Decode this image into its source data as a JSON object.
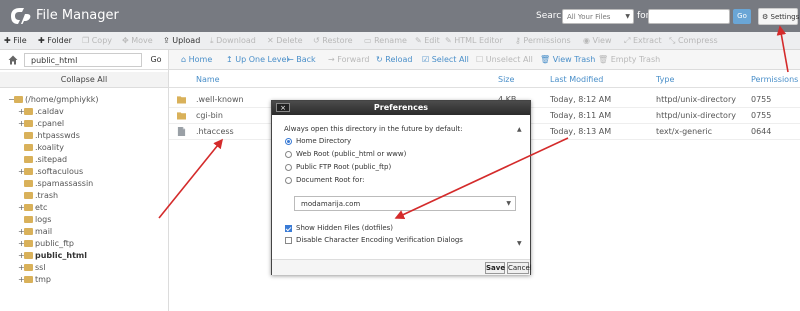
{
  "header": {
    "app_title": "File Manager",
    "search_label": "Search",
    "search_scope": "All Your Files",
    "for_label": "for",
    "search_value": "",
    "go_label": "Go",
    "settings_label": "Settings"
  },
  "toolbar": {
    "items": [
      {
        "label": "File",
        "icon": "plus-icon",
        "enabled": true
      },
      {
        "label": "Folder",
        "icon": "plus-icon",
        "enabled": true
      },
      {
        "label": "Copy",
        "icon": "copy-icon",
        "enabled": false
      },
      {
        "label": "Move",
        "icon": "move-icon",
        "enabled": false
      },
      {
        "label": "Upload",
        "icon": "upload-icon",
        "enabled": true
      },
      {
        "label": "Download",
        "icon": "download-icon",
        "enabled": false
      },
      {
        "label": "Delete",
        "icon": "delete-icon",
        "enabled": false
      },
      {
        "label": "Restore",
        "icon": "restore-icon",
        "enabled": false
      },
      {
        "label": "Rename",
        "icon": "rename-icon",
        "enabled": false
      },
      {
        "label": "Edit",
        "icon": "pencil-icon",
        "enabled": false
      },
      {
        "label": "HTML Editor",
        "icon": "pencil-icon",
        "enabled": false
      },
      {
        "label": "Permissions",
        "icon": "key-icon",
        "enabled": false
      },
      {
        "label": "View",
        "icon": "eye-icon",
        "enabled": false
      },
      {
        "label": "Extract",
        "icon": "expand-icon",
        "enabled": false
      },
      {
        "label": "Compress",
        "icon": "compress-icon",
        "enabled": false
      }
    ]
  },
  "sidebar": {
    "path_value": "public_html",
    "go_label": "Go",
    "collapse_label": "Collapse All",
    "tree": [
      {
        "pm": "−",
        "label": "(/home/gmphiykk)",
        "level": 0,
        "bold": false
      },
      {
        "pm": "+",
        "label": ".caldav",
        "level": 1,
        "bold": false
      },
      {
        "pm": "+",
        "label": ".cpanel",
        "level": 1,
        "bold": false
      },
      {
        "pm": "",
        "label": ".htpasswds",
        "level": 1,
        "bold": false
      },
      {
        "pm": "",
        "label": ".koality",
        "level": 1,
        "bold": false
      },
      {
        "pm": "",
        "label": ".sitepad",
        "level": 1,
        "bold": false
      },
      {
        "pm": "+",
        "label": ".softaculous",
        "level": 1,
        "bold": false
      },
      {
        "pm": "",
        "label": ".spamassassin",
        "level": 1,
        "bold": false
      },
      {
        "pm": "",
        "label": ".trash",
        "level": 1,
        "bold": false
      },
      {
        "pm": "+",
        "label": "etc",
        "level": 1,
        "bold": false
      },
      {
        "pm": "",
        "label": "logs",
        "level": 1,
        "bold": false
      },
      {
        "pm": "+",
        "label": "mail",
        "level": 1,
        "bold": false
      },
      {
        "pm": "+",
        "label": "public_ftp",
        "level": 1,
        "bold": false
      },
      {
        "pm": "+",
        "label": "public_html",
        "level": 1,
        "bold": true
      },
      {
        "pm": "+",
        "label": "ssl",
        "level": 1,
        "bold": false
      },
      {
        "pm": "+",
        "label": "tmp",
        "level": 1,
        "bold": false
      }
    ]
  },
  "actionbar": {
    "items": [
      {
        "label": "Home",
        "icon": "home-icon",
        "enabled": true
      },
      {
        "label": "Up One Level",
        "icon": "up-icon",
        "enabled": true
      },
      {
        "label": "Back",
        "icon": "back-arrow-icon",
        "enabled": true
      },
      {
        "label": "Forward",
        "icon": "forward-arrow-icon",
        "enabled": false
      },
      {
        "label": "Reload",
        "icon": "reload-icon",
        "enabled": true
      },
      {
        "label": "Select All",
        "icon": "checkbox-icon",
        "enabled": true
      },
      {
        "label": "Unselect All",
        "icon": "checkbox-empty-icon",
        "enabled": false
      },
      {
        "label": "View Trash",
        "icon": "trash-icon",
        "enabled": true
      },
      {
        "label": "Empty Trash",
        "icon": "trash-icon",
        "enabled": false
      }
    ]
  },
  "table": {
    "columns": [
      "Name",
      "Size",
      "Last Modified",
      "Type",
      "Permissions"
    ],
    "rows": [
      {
        "icon": "folder-icon",
        "name": ".well-known",
        "size": "4 KB",
        "modified": "Today, 8:12 AM",
        "type": "httpd/unix-directory",
        "perms": "0755"
      },
      {
        "icon": "folder-icon",
        "name": "cgi-bin",
        "size": "",
        "modified": "Today, 8:11 AM",
        "type": "httpd/unix-directory",
        "perms": "0755"
      },
      {
        "icon": "file-icon",
        "name": ".htaccess",
        "size": "",
        "modified": "Today, 8:13 AM",
        "type": "text/x-generic",
        "perms": "0644"
      }
    ]
  },
  "modal": {
    "title": "Preferences",
    "close_label": "×",
    "intro": "Always open this directory in the future by default:",
    "options": [
      {
        "label": "Home Directory",
        "checked": true
      },
      {
        "label": "Web Root (public_html or www)",
        "checked": false
      },
      {
        "label": "Public FTP Root (public_ftp)",
        "checked": false
      },
      {
        "label": "Document Root for:",
        "checked": false
      }
    ],
    "domain_value": "modamarija.com",
    "checkboxes": [
      {
        "label": "Show Hidden Files (dotfiles)",
        "checked": true
      },
      {
        "label": "Disable Character Encoding Verification Dialogs",
        "checked": false
      }
    ],
    "save_label": "Save",
    "cancel_label": "Cancel"
  },
  "colors": {
    "header_bg": "#777a81",
    "link_blue": "#4a8fc9",
    "annotation_red": "#d42b2b",
    "folder": "#d9b15a"
  }
}
